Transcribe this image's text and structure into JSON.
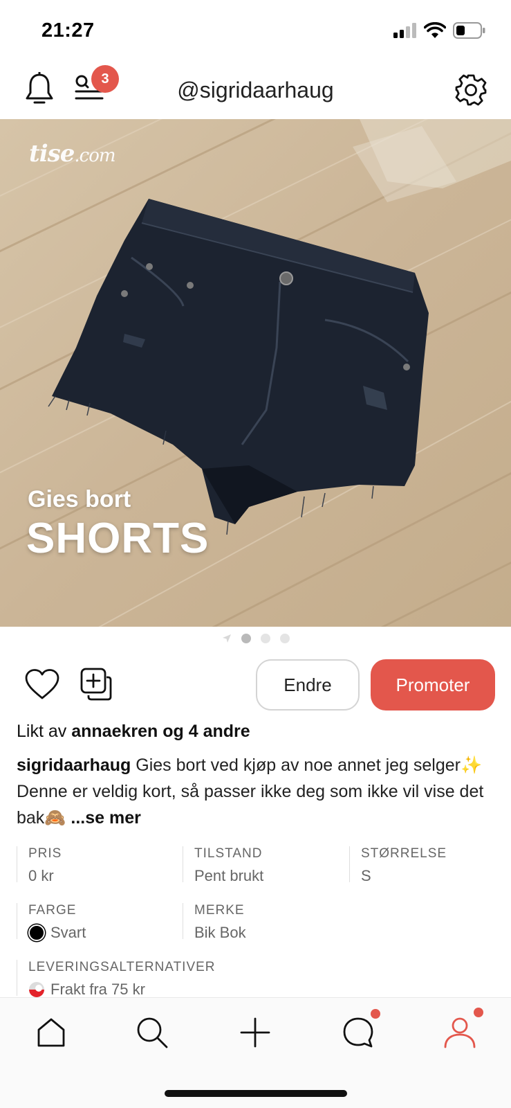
{
  "status_bar": {
    "time": "21:27"
  },
  "header": {
    "username": "@sigridaarhaug",
    "notification_badge": "3"
  },
  "hero": {
    "watermark_brand": "tise",
    "watermark_domain": ".com",
    "kicker": "Gies bort",
    "title": "SHORTS",
    "image_subject": "black distressed denim shorts on wooden floor",
    "carousel_count": 3,
    "carousel_active_index": 0
  },
  "actions": {
    "edit_label": "Endre",
    "promote_label": "Promoter"
  },
  "likes": {
    "prefix": "Likt av",
    "users": "annaekren og 4 andre"
  },
  "caption": {
    "author": "sigridaarhaug",
    "text": "Gies bort ved kjøp av noe annet jeg selger✨ Denne er veldig kort, så passer ikke deg som ikke vil vise det bak🙈",
    "more": "...se mer"
  },
  "details": {
    "price_label": "PRIS",
    "price_value": "0 kr",
    "condition_label": "TILSTAND",
    "condition_value": "Pent brukt",
    "size_label": "STØRRELSE",
    "size_value": "S",
    "color_label": "FARGE",
    "color_value": "Svart",
    "brand_label": "MERKE",
    "brand_value": "Bik Bok",
    "delivery_label": "LEVERINGSALTERNATIVER",
    "delivery_value": "Frakt fra 75 kr"
  },
  "tabbar": {
    "items": [
      "home-icon",
      "search-icon",
      "add-icon",
      "chat-icon",
      "profile-icon"
    ],
    "active": "profile-icon"
  },
  "colors": {
    "accent": "#e3574c",
    "text": "#111111",
    "muted": "#666666"
  }
}
